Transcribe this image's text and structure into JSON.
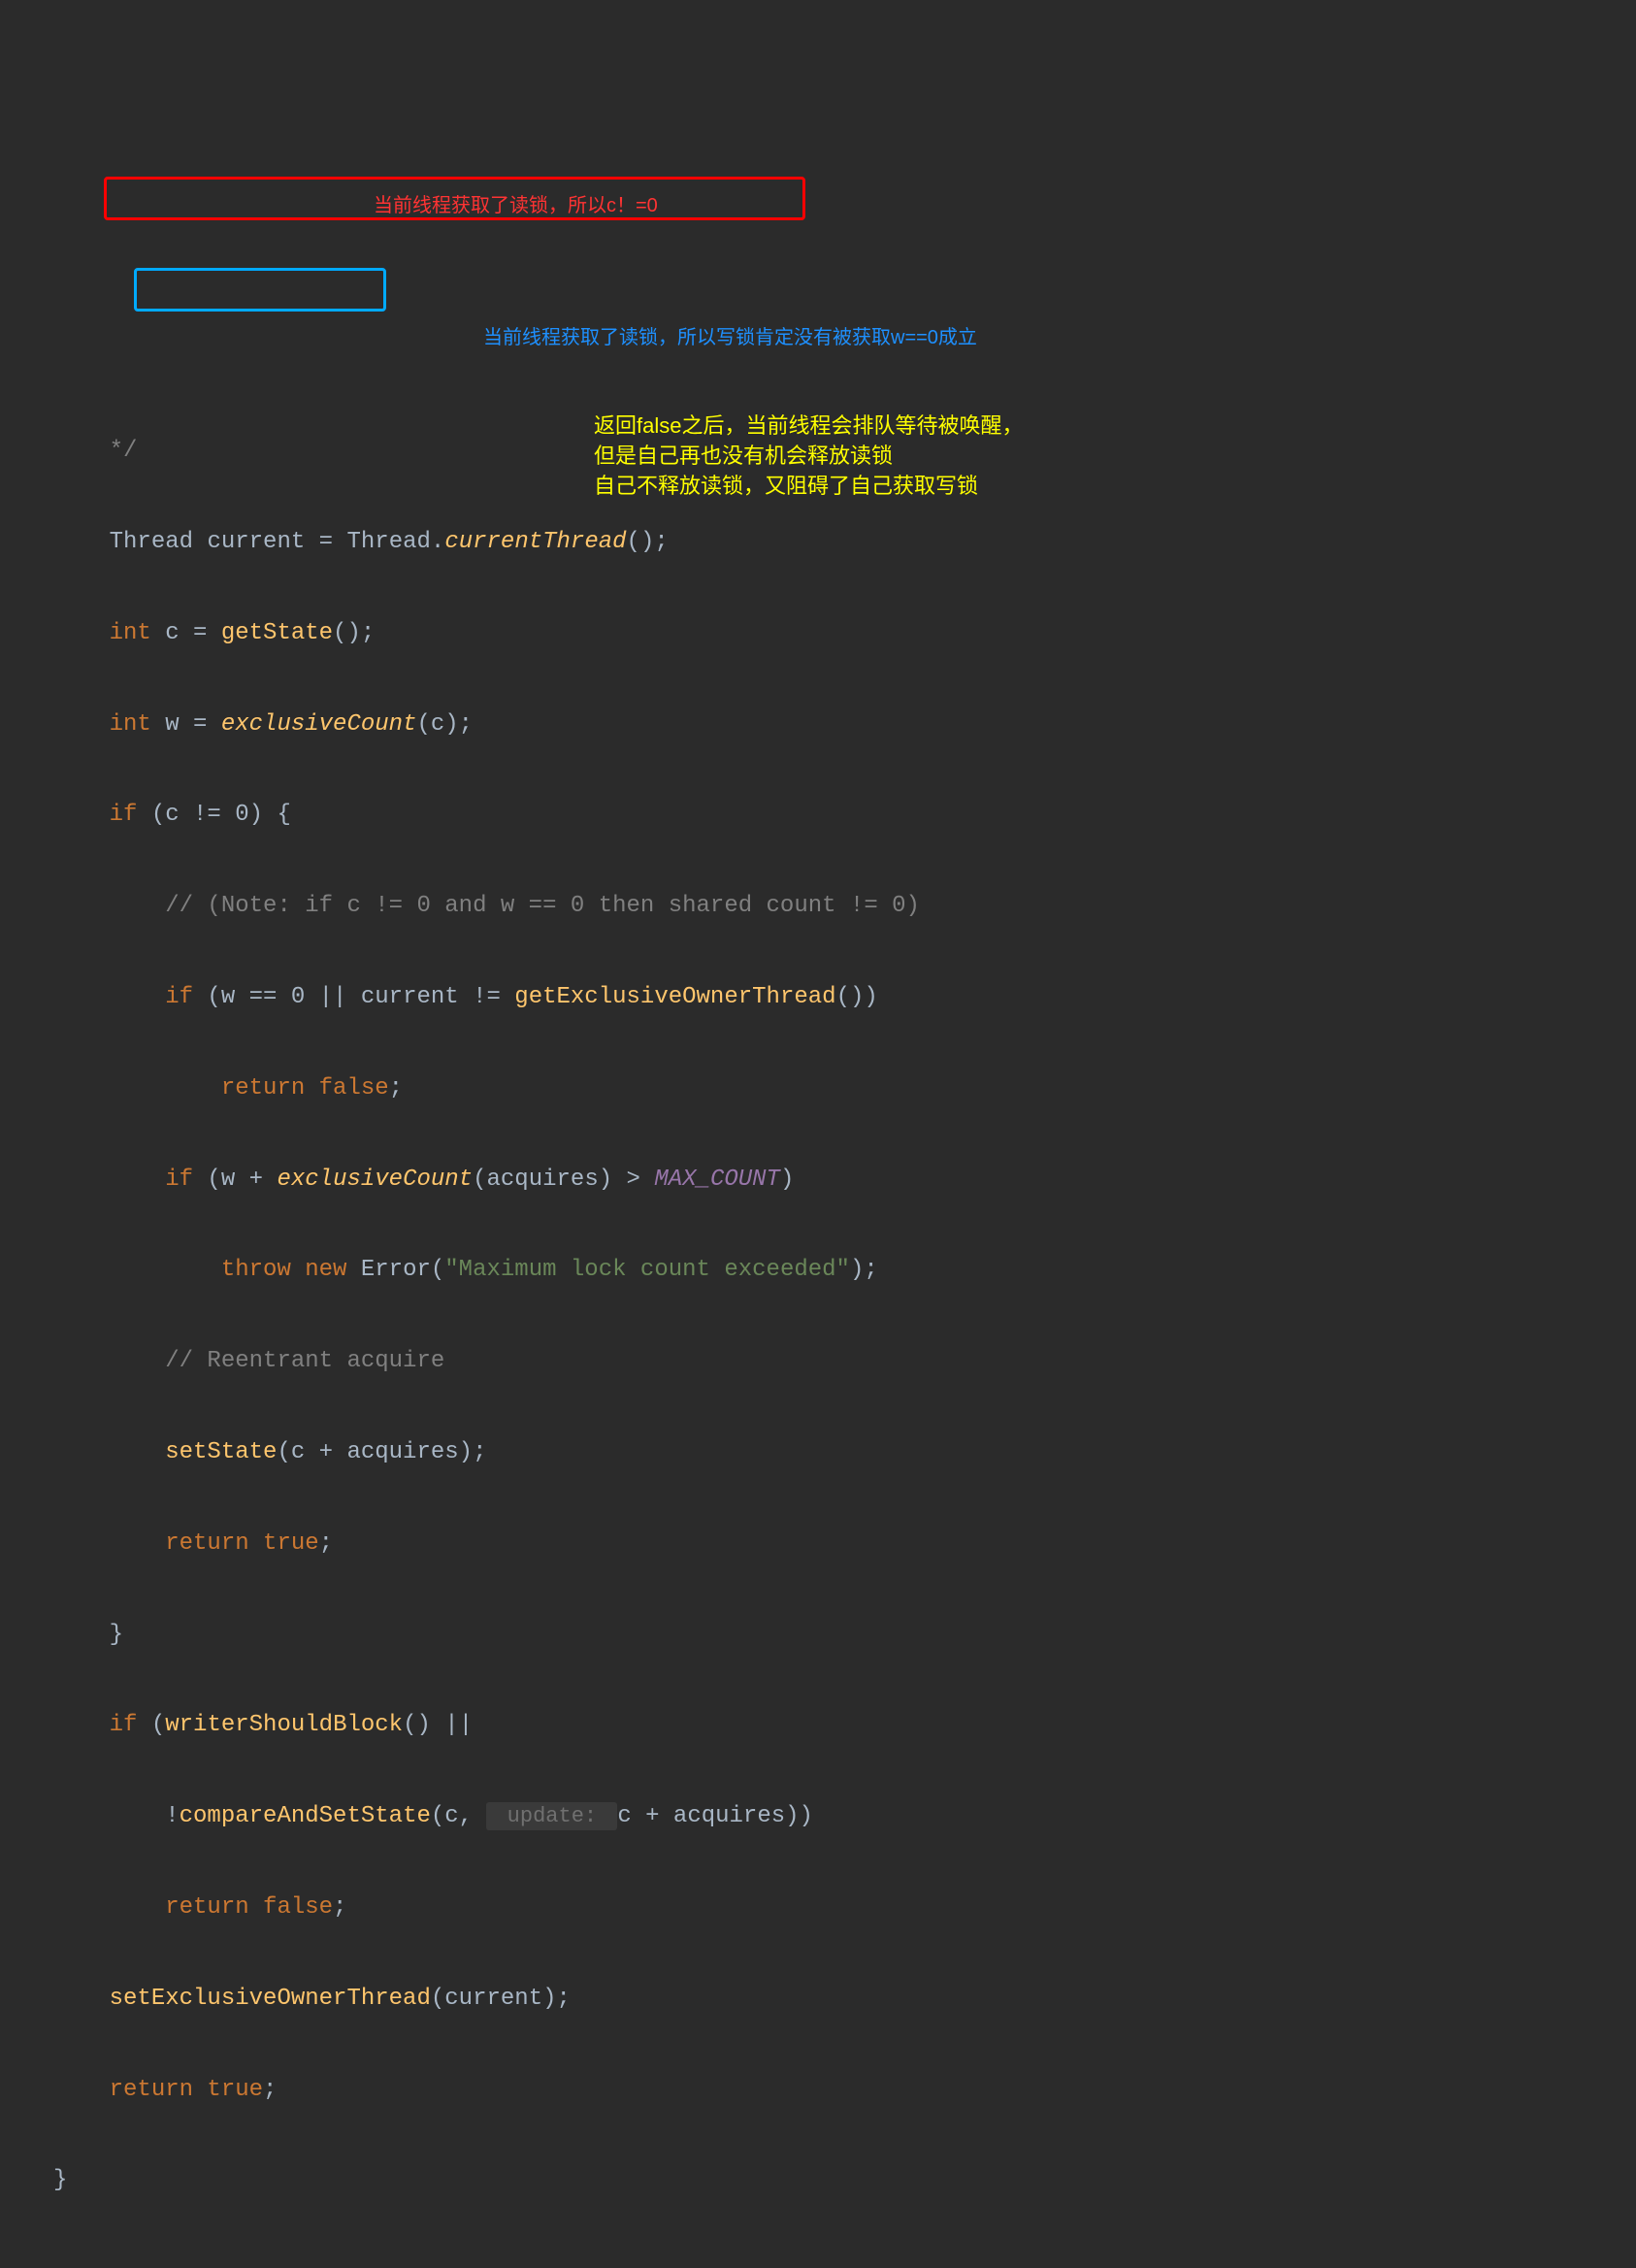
{
  "code": {
    "l0_fragment": "*/",
    "l1": {
      "type": "Thread",
      "var": "current",
      "eq": " = ",
      "class": "Thread",
      "dot": ".",
      "method": "currentThread",
      "paren": "();"
    },
    "l2": {
      "kw": "int ",
      "var": "c = ",
      "method": "getState",
      "paren": "();"
    },
    "l3": {
      "kw": "int ",
      "var": "w = ",
      "method": "exclusiveCount",
      "args": "(c);"
    },
    "l4": {
      "kw": "if",
      "cond": " (c != 0) {"
    },
    "l5_comment": "// (Note: if c != 0 and w == 0 then shared count != 0)",
    "l6": {
      "kw": "if",
      "cond_a": " (w == 0 ||",
      "cond_b": " current != ",
      "method": "getExclusiveOwnerThread",
      "paren": "())"
    },
    "l7": {
      "kw": "return false",
      "semi": ";"
    },
    "l8": {
      "kw": "if",
      "open": " (w + ",
      "method": "exclusiveCount",
      "mid": "(acquires) > ",
      "const": "MAX_COUNT",
      "close": ")"
    },
    "l9": {
      "kw": "throw new ",
      "class": "Error",
      "open": "(",
      "str": "\"Maximum lock count exceeded\"",
      "close": ");"
    },
    "l10_comment": "// Reentrant acquire",
    "l11": {
      "method": "setState",
      "args": "(c + acquires);"
    },
    "l12": {
      "kw": "return true",
      "semi": ";"
    },
    "l13_brace": "}",
    "l14": {
      "kw": "if",
      "open": " (",
      "method": "writerShouldBlock",
      "close": "() ||"
    },
    "l15": {
      "neg": "!",
      "method": "compareAndSetState",
      "open": "(c, ",
      "hint": " update: ",
      "close": "c + acquires))"
    },
    "l16": {
      "kw": "return false",
      "semi": ";"
    },
    "l17": {
      "method": "setExclusiveOwnerThread",
      "args": "(current);"
    },
    "l18": {
      "kw": "return true",
      "semi": ";"
    },
    "l19_brace": "}"
  },
  "annotations": {
    "red_text": "当前线程获取了读锁，所以c！=0",
    "blue_text": "当前线程获取了读锁，所以写锁肯定没有被获取w==0成立",
    "yellow_line1": "返回false之后，当前线程会排队等待被唤醒，",
    "yellow_line2": "但是自己再也没有机会释放读锁",
    "yellow_line3": "自己不释放读锁，又阻碍了自己获取写锁"
  }
}
